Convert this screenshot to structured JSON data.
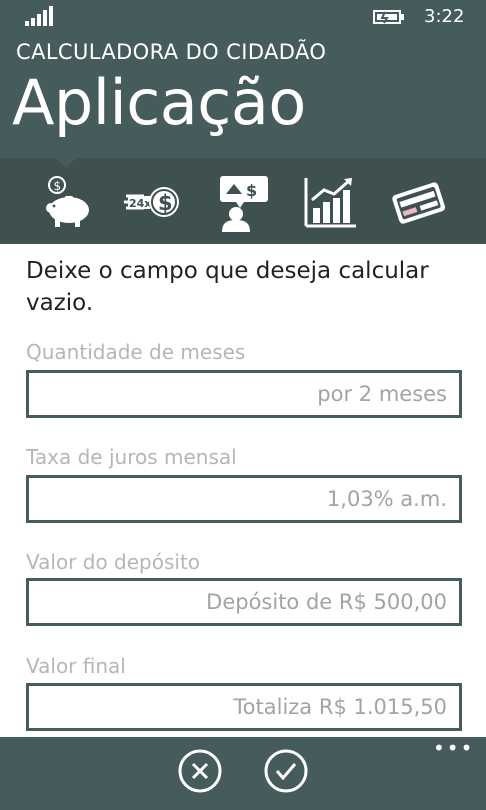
{
  "status_bar": {
    "time": "3:22",
    "signal_icon": "signal-bars-icon",
    "battery_icon": "battery-charging-icon"
  },
  "header": {
    "app_title": "CALCULADORA DO CIDADÃO",
    "page_title": "Aplicação"
  },
  "pivot": {
    "items": [
      {
        "icon": "piggy-bank-icon",
        "selected": true
      },
      {
        "icon": "installments-24x-icon",
        "selected": false
      },
      {
        "icon": "person-presentation-icon",
        "selected": false
      },
      {
        "icon": "bar-chart-icon",
        "selected": false
      },
      {
        "icon": "credit-card-icon",
        "selected": false
      }
    ]
  },
  "main": {
    "instruction": "Deixe o campo que deseja calcular vazio.",
    "fields": [
      {
        "label": "Quantidade de meses",
        "value": "por 2 meses"
      },
      {
        "label": "Taxa de juros mensal",
        "value": "1,03% a.m."
      },
      {
        "label": "Valor do depósito",
        "value": "Depósito de R$ 500,00"
      },
      {
        "label": "Valor final",
        "value": "Totaliza R$ 1.015,50"
      }
    ]
  },
  "app_bar": {
    "buttons": [
      {
        "icon": "cancel-icon"
      },
      {
        "icon": "check-icon"
      }
    ],
    "more": "•••"
  },
  "colors": {
    "header": "#465c5c",
    "pivot_bar": "#3e5050",
    "label": "#b6b6b6",
    "input_border": "#465c5c"
  }
}
